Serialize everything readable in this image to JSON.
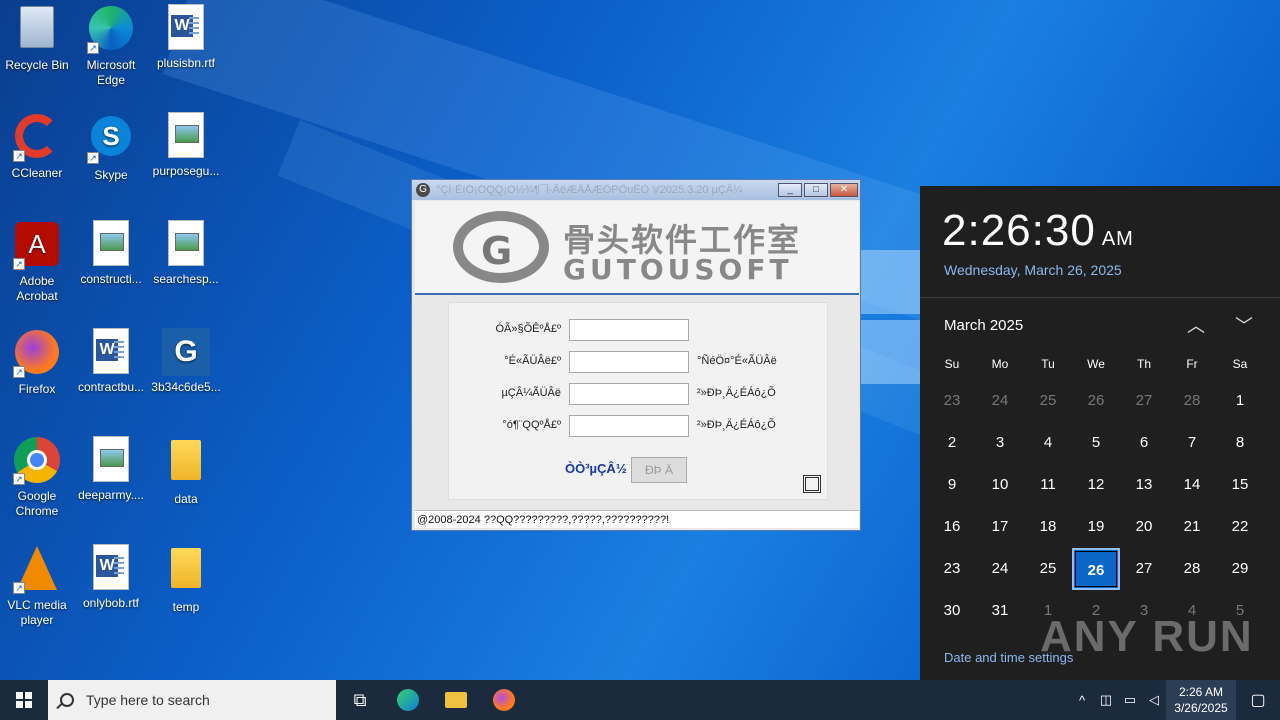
{
  "desktop": {
    "icons": [
      {
        "label": "Recycle Bin",
        "icon": "recycle-bin-icon"
      },
      {
        "label": "Microsoft Edge",
        "icon": "edge-icon"
      },
      {
        "label": "plusisbn.rtf",
        "icon": "word-doc-icon"
      },
      {
        "label": "CCleaner",
        "icon": "ccleaner-icon"
      },
      {
        "label": "Skype",
        "icon": "skype-icon"
      },
      {
        "label": "purposegu...",
        "icon": "image-file-icon"
      },
      {
        "label": "Adobe Acrobat",
        "icon": "acrobat-icon"
      },
      {
        "label": "constructi...",
        "icon": "image-file-icon"
      },
      {
        "label": "searchesp...",
        "icon": "image-file-icon"
      },
      {
        "label": "Firefox",
        "icon": "firefox-icon"
      },
      {
        "label": "contractbu...",
        "icon": "word-doc-icon"
      },
      {
        "label": "3b34c6de5...",
        "icon": "gutousoft-app-icon"
      },
      {
        "label": "Google Chrome",
        "icon": "chrome-icon"
      },
      {
        "label": "deeparmy....",
        "icon": "image-file-icon"
      },
      {
        "label": "data",
        "icon": "folder-icon"
      },
      {
        "label": "VLC media player",
        "icon": "vlc-icon"
      },
      {
        "label": "onlybob.rtf",
        "icon": "word-doc-icon"
      },
      {
        "label": "temp",
        "icon": "folder-icon"
      }
    ]
  },
  "app_window": {
    "title": "°ÇÍ·ÈíÓ¡ÓQQ¡Ó½¾¶¯Î-ÃëÆÄÅÆÖPÖuÊÖ V2025.3.20 µÇÂ¼",
    "buttons": {
      "minimize": "_",
      "maximize": "□",
      "close": "✕"
    },
    "logo_cn": "骨头软件工作室",
    "logo_en": "GUTOUSOFT",
    "form": {
      "rows": [
        {
          "label": "ÓÃ»§ÕÊºÅ£º",
          "right_label": ""
        },
        {
          "label": "°É«ÃÜÂë£º",
          "right_label": "°ÑéÖ¤°É«ÃÜÂë"
        },
        {
          "label": "µÇÂ¼ÃÜÂë",
          "right_label": "²»ÐÞ¸Ä¿ÉÁô¿Õ"
        },
        {
          "label": "°ó¶¨QQºÅ£º",
          "right_label": "²»ÐÞ¸Ä¿ÉÁô¿Õ"
        }
      ],
      "link": "ÒÒ³µÇÂ½",
      "login_button": "ÐÞ Ä"
    },
    "status": "@2008-2024  ??QQ?????????,?????,??????????!"
  },
  "clock_flyout": {
    "time": "2:26:30",
    "ampm": "AM",
    "date": "Wednesday, March 26, 2025",
    "month": "March 2025",
    "weekdays": [
      "Su",
      "Mo",
      "Tu",
      "We",
      "Th",
      "Fr",
      "Sa"
    ],
    "weeks": [
      [
        {
          "d": "23",
          "dim": true
        },
        {
          "d": "24",
          "dim": true
        },
        {
          "d": "25",
          "dim": true
        },
        {
          "d": "26",
          "dim": true
        },
        {
          "d": "27",
          "dim": true
        },
        {
          "d": "28",
          "dim": true
        },
        {
          "d": "1"
        }
      ],
      [
        {
          "d": "2"
        },
        {
          "d": "3"
        },
        {
          "d": "4"
        },
        {
          "d": "5"
        },
        {
          "d": "6"
        },
        {
          "d": "7"
        },
        {
          "d": "8"
        }
      ],
      [
        {
          "d": "9"
        },
        {
          "d": "10"
        },
        {
          "d": "11"
        },
        {
          "d": "12"
        },
        {
          "d": "13"
        },
        {
          "d": "14"
        },
        {
          "d": "15"
        }
      ],
      [
        {
          "d": "16"
        },
        {
          "d": "17"
        },
        {
          "d": "18"
        },
        {
          "d": "19"
        },
        {
          "d": "20"
        },
        {
          "d": "21"
        },
        {
          "d": "22"
        }
      ],
      [
        {
          "d": "23"
        },
        {
          "d": "24"
        },
        {
          "d": "25"
        },
        {
          "d": "26",
          "today": true
        },
        {
          "d": "27"
        },
        {
          "d": "28"
        },
        {
          "d": "29"
        }
      ],
      [
        {
          "d": "30"
        },
        {
          "d": "31"
        },
        {
          "d": "1",
          "dim": true
        },
        {
          "d": "2",
          "dim": true
        },
        {
          "d": "3",
          "dim": true
        },
        {
          "d": "4",
          "dim": true
        },
        {
          "d": "5",
          "dim": true
        }
      ]
    ],
    "settings_link": "Date and time settings"
  },
  "watermark": "ANY RUN",
  "taskbar": {
    "search_placeholder": "Type here to search",
    "clock_time": "2:26 AM",
    "clock_date": "3/26/2025"
  },
  "colors": {
    "accent": "#0a67c8",
    "flyout_bg": "#1f1f1f",
    "taskbar_bg": "#1b2a3c"
  }
}
